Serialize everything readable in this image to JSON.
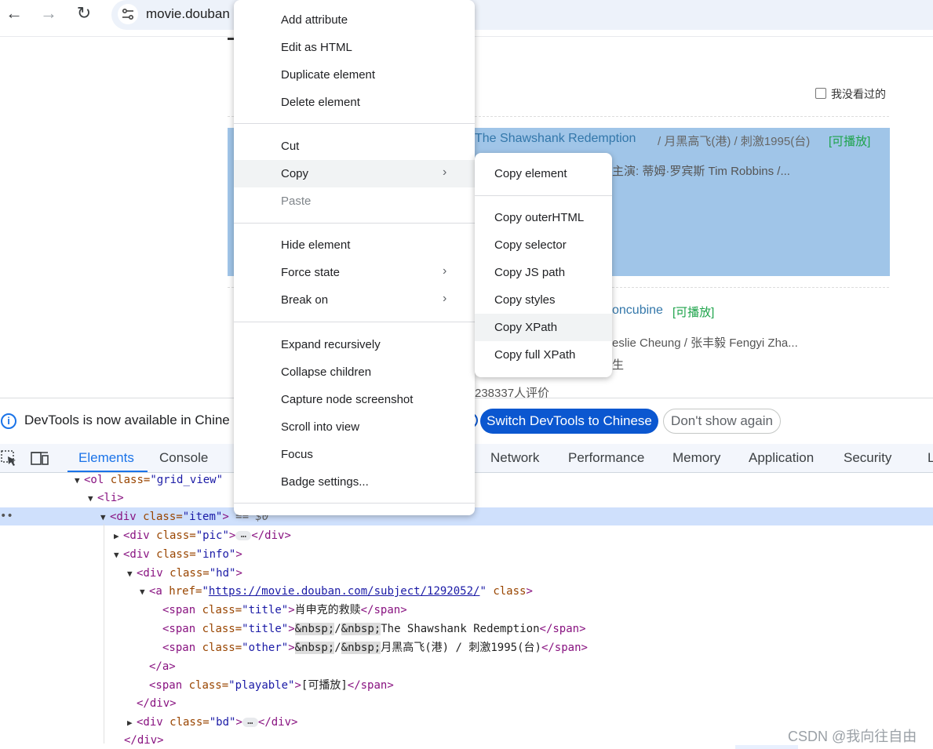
{
  "browser": {
    "back_icon": "←",
    "forward_icon": "→",
    "reload_icon": "↻",
    "site_info_icon": "⚙",
    "url": "movie.douban"
  },
  "page": {
    "checkbox_label": "我没看过的",
    "movie1": {
      "title_en": "The Shawshank Redemption",
      "title_other": "/ 月黑高飞(港) / 刺激1995(台)",
      "playable": "[可播放]",
      "cast": "主演: 蒂姆·罗宾斯 Tim Robbins /..."
    },
    "movie2": {
      "title_en": "oncubine",
      "playable": "[可播放]",
      "cast": "eslie Cheung / 张丰毅 Fengyi Zha...",
      "extra": "生",
      "rating_count": "238337人评价"
    }
  },
  "infobar": {
    "text": "DevTools is now available in Chine",
    "switch_label": "Switch DevTools to Chinese",
    "dont_show_label": "Don't show again"
  },
  "devtools": {
    "tabs": {
      "elements": "Elements",
      "console": "Console",
      "network": "Network",
      "performance": "Performance",
      "memory": "Memory",
      "application": "Application",
      "security": "Security",
      "more": "L"
    },
    "tree": {
      "ol_open": "<ol",
      "ol_class_attr": " class=",
      "ol_class_val": "\"grid_view\"",
      "li": "<li>",
      "div_item_open": "<div",
      "div_item_attr": " class=",
      "div_item_val": "\"item\"",
      "div_item_close": ">",
      "div_item_marker": " == $0",
      "div_pic_open": "<div",
      "div_pic_attr": " class=",
      "div_pic_val": "\"pic\"",
      "div_pic_close": ">",
      "ellipsis": "…",
      "div_end": "</div>",
      "div_info_open": "<div",
      "div_info_attr": " class=",
      "div_info_val": "\"info\"",
      "div_info_close": ">",
      "div_hd_open": "<div",
      "div_hd_attr": " class=",
      "div_hd_val": "\"hd\"",
      "div_hd_close": ">",
      "a_open": "<a",
      "a_href_attr": " href=",
      "a_href_q1": "\"",
      "a_href_val": "https://movie.douban.com/subject/1292052/",
      "a_href_q2": "\"",
      "a_class_attr": " class",
      "a_class_close": ">",
      "span1_open": "<span",
      "span1_attr": " class=",
      "span1_val": "\"title\"",
      "span1_gt": ">",
      "span1_text": "肖申克的救赎",
      "span_close": "</span>",
      "span2_open": "<span",
      "span2_attr": " class=",
      "span2_val": "\"title\"",
      "span2_gt": ">",
      "nbsp": "&nbsp;",
      "slash": "/",
      "span2_text": "The Shawshank Redemption",
      "span3_open": "<span",
      "span3_attr": " class=",
      "span3_val": "\"other\"",
      "span3_gt": ">",
      "span3_text": "月黑高飞(港) / 刺激1995(台)",
      "a_end": "</a>",
      "span4_open": "<span",
      "span4_attr": " class=",
      "span4_val": "\"playable\"",
      "span4_gt": ">",
      "span4_text": "[可播放]",
      "div_bd_open": "<div",
      "div_bd_attr": " class=",
      "div_bd_val": "\"bd\"",
      "div_bd_close": ">",
      "dots": "••"
    }
  },
  "context_menu": {
    "items": [
      "Add attribute",
      "Edit as HTML",
      "Duplicate element",
      "Delete element",
      "Cut",
      "Copy",
      "Paste",
      "Hide element",
      "Force state",
      "Break on",
      "Expand recursively",
      "Collapse children",
      "Capture node screenshot",
      "Scroll into view",
      "Focus",
      "Badge settings..."
    ],
    "chevron": "›"
  },
  "copy_submenu": {
    "items": [
      "Copy element",
      "Copy outerHTML",
      "Copy selector",
      "Copy JS path",
      "Copy styles",
      "Copy XPath",
      "Copy full XPath"
    ]
  },
  "watermark": "CSDN @我向往自由"
}
